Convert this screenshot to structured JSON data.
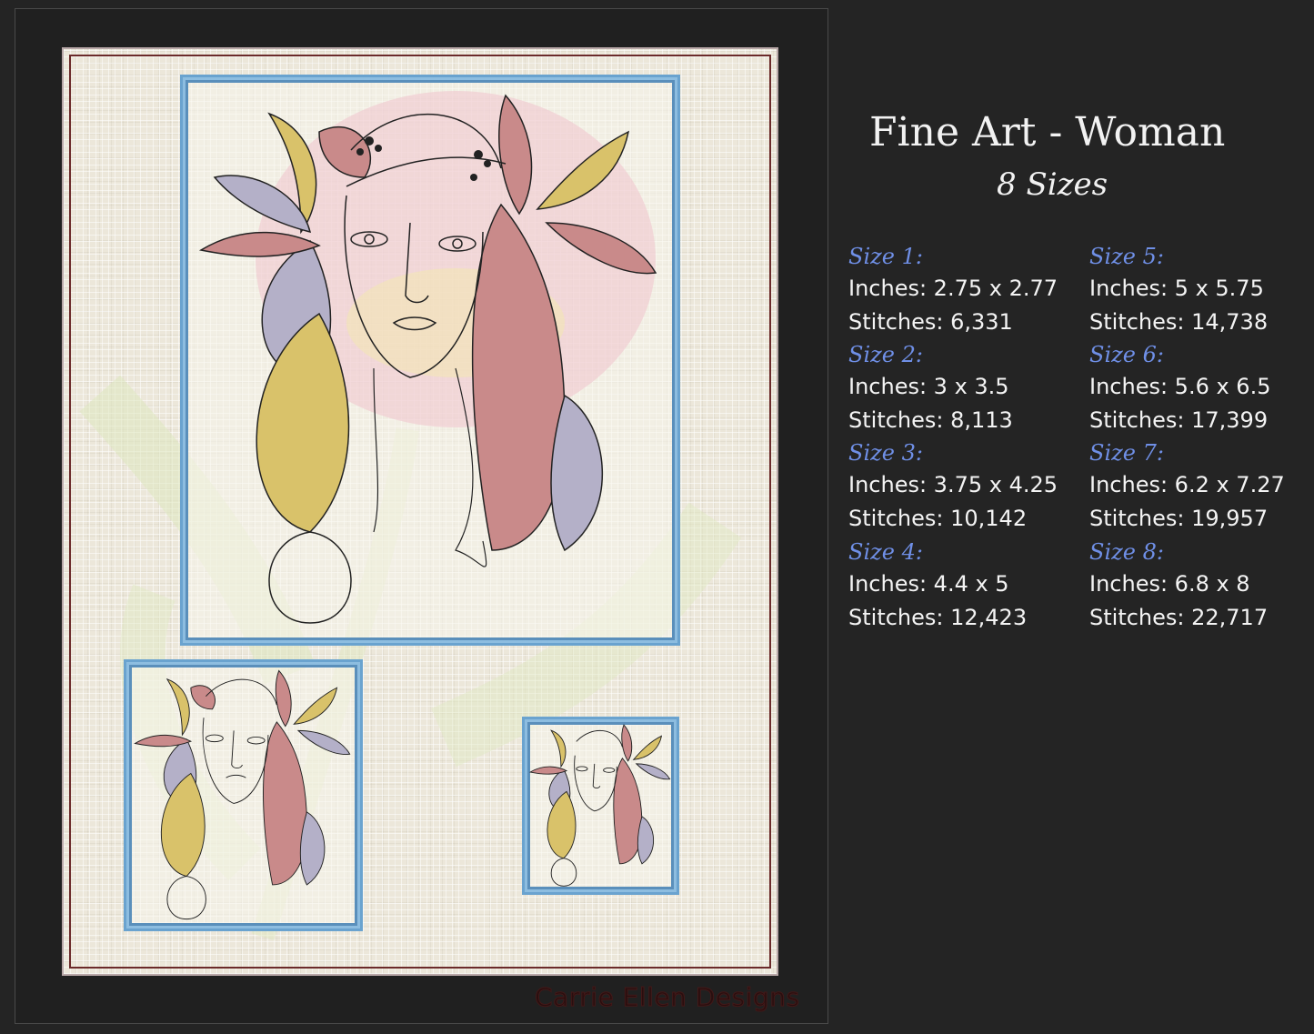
{
  "header": {
    "title": "Fine Art - Woman",
    "subtitle": "8 Sizes"
  },
  "watermark": "Carrie Ellen Designs",
  "sizes": [
    {
      "label": "Size 1:",
      "inches": "Inches: 2.75 x 2.77",
      "stitches": "Stitches: 6,331"
    },
    {
      "label": "Size 2:",
      "inches": "Inches: 3 x 3.5",
      "stitches": "Stitches: 8,113"
    },
    {
      "label": "Size 3:",
      "inches": "Inches: 3.75 x 4.25",
      "stitches": "Stitches: 10,142"
    },
    {
      "label": "Size 4:",
      "inches": "Inches: 4.4 x 5",
      "stitches": "Stitches: 12,423"
    },
    {
      "label": "Size 5:",
      "inches": "Inches: 5 x 5.75",
      "stitches": "Stitches: 14,738"
    },
    {
      "label": "Size 6:",
      "inches": "Inches: 5.6 x 6.5",
      "stitches": "Stitches: 17,399"
    },
    {
      "label": "Size 7:",
      "inches": "Inches: 6.2 x 7.27",
      "stitches": "Stitches: 19,957"
    },
    {
      "label": "Size 8:",
      "inches": "Inches: 6.8 x 8",
      "stitches": "Stitches: 22,717"
    }
  ],
  "colors": {
    "background": "#242424",
    "size_label": "#6f8fe6",
    "frame_blue": "#6aa3cf",
    "hair_pink": "#c98a8a",
    "hair_yellow": "#d9c26a",
    "hair_lilac": "#b4b0c8",
    "bg_flower_pink": "#f0c6cf",
    "bg_leaf_green": "#d6e3b0"
  },
  "images": {
    "main": "embroidery-woman-portrait-large",
    "small_left": "embroidery-woman-portrait-medium",
    "small_right": "embroidery-woman-portrait-small"
  }
}
